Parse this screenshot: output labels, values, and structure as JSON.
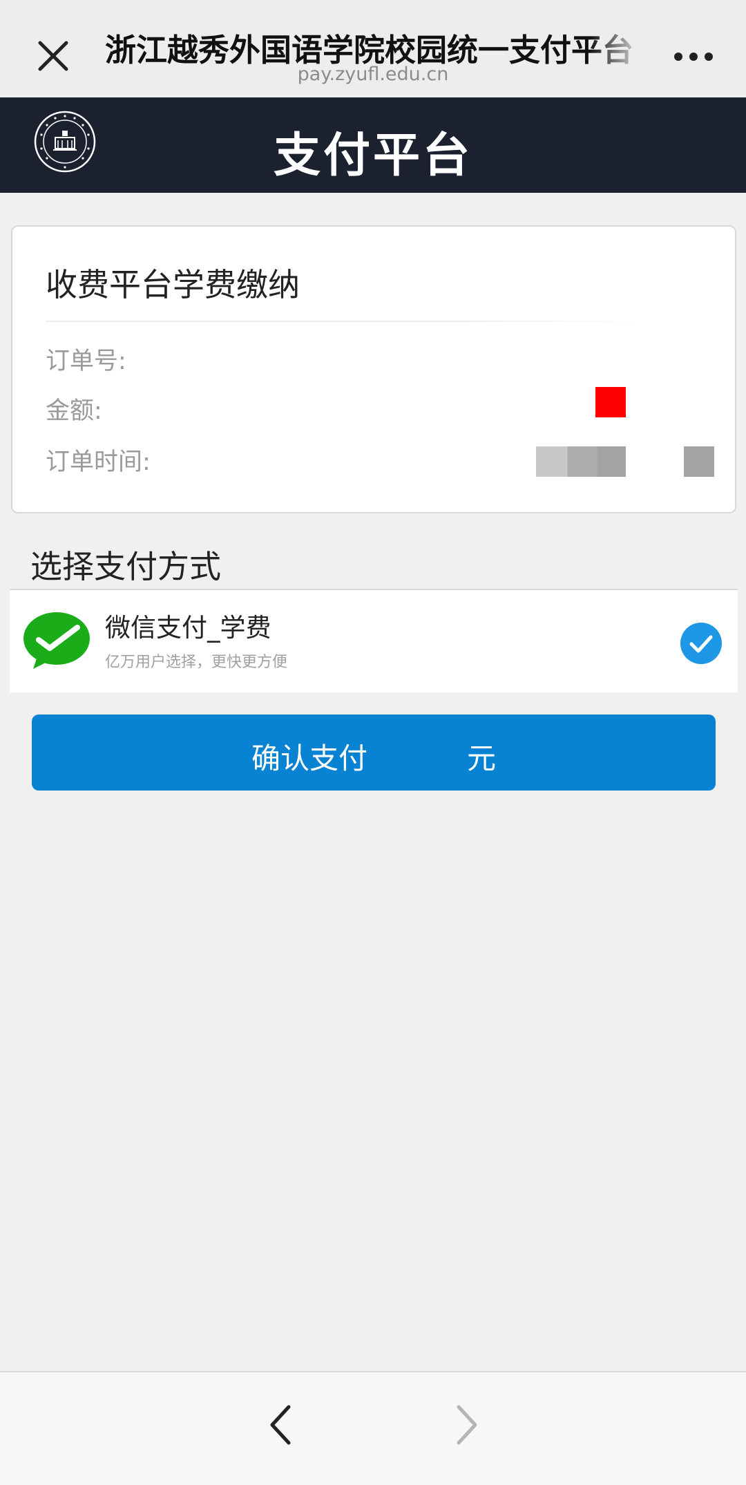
{
  "browser": {
    "title": "浙江越秀外国语学院校园统一支付平台",
    "url": "pay.zyufl.edu.cn"
  },
  "header": {
    "title": "支付平台"
  },
  "order": {
    "title": "收费平台学费缴纳",
    "order_no_label": "订单号:",
    "amount_label": "金额:",
    "time_label": "订单时间:"
  },
  "payment": {
    "section_title": "选择支付方式",
    "method_name": "微信支付_学费",
    "method_desc": "亿万用户选择，更快更方便",
    "selected": true
  },
  "confirm": {
    "label": "确认支付",
    "unit": "元"
  },
  "colors": {
    "header_bg": "#1c2130",
    "primary": "#0882d2",
    "wechat_green": "#1aad19",
    "check_blue": "#1e98e6"
  },
  "icons": [
    "close-icon",
    "more-icon",
    "school-logo",
    "wechat-icon",
    "check-circle-icon",
    "back-arrow-icon",
    "forward-arrow-icon"
  ]
}
